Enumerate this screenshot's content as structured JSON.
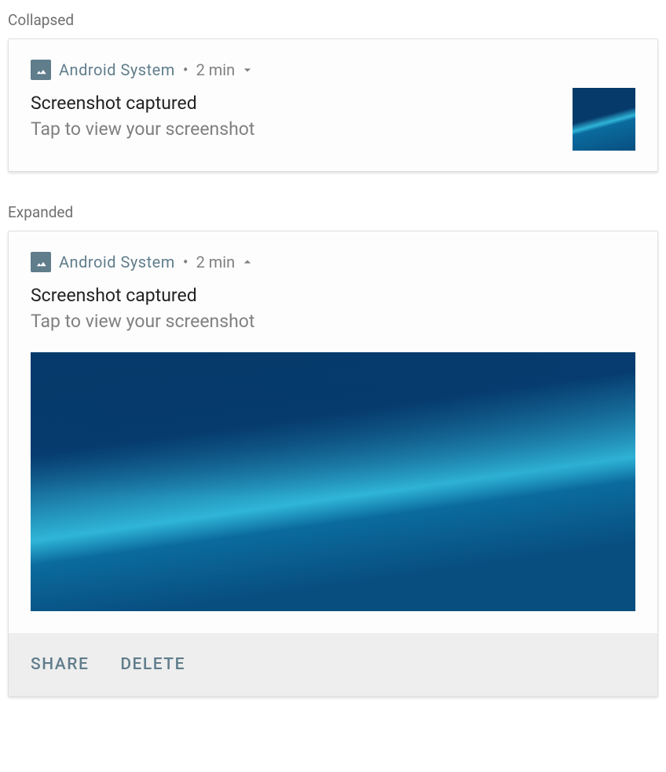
{
  "collapsed": {
    "section_label": "Collapsed",
    "app_name": "Android  System",
    "separator": "•",
    "timestamp": "2 min",
    "title": "Screenshot captured",
    "subtitle": "Tap to view your screenshot"
  },
  "expanded": {
    "section_label": "Expanded",
    "app_name": "Android  System",
    "separator": "•",
    "timestamp": "2 min",
    "title": "Screenshot captured",
    "subtitle": "Tap to view your screenshot",
    "actions": {
      "share": "SHARE",
      "delete": "DELETE"
    }
  }
}
